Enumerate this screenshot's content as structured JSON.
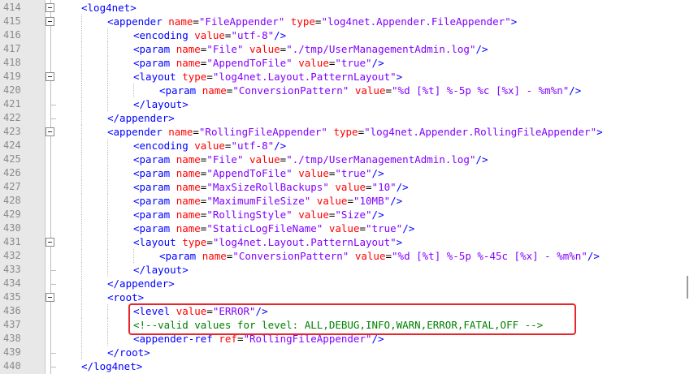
{
  "editor": {
    "lines": [
      {
        "num": "414",
        "fold": "box",
        "indent": 0,
        "tokens": [
          {
            "t": "t",
            "s": "<log4net>"
          }
        ]
      },
      {
        "num": "415",
        "fold": "box",
        "indent": 1,
        "tokens": [
          {
            "t": "t",
            "s": "<appender "
          },
          {
            "t": "a",
            "s": "name"
          },
          {
            "t": "p",
            "s": "="
          },
          {
            "t": "v",
            "s": "\"FileAppender\""
          },
          {
            "t": "p",
            "s": " "
          },
          {
            "t": "a",
            "s": "type"
          },
          {
            "t": "p",
            "s": "="
          },
          {
            "t": "v",
            "s": "\"log4net.Appender.FileAppender\""
          },
          {
            "t": "t",
            "s": ">"
          }
        ]
      },
      {
        "num": "416",
        "fold": "",
        "indent": 2,
        "tokens": [
          {
            "t": "t",
            "s": "<encoding "
          },
          {
            "t": "a",
            "s": "value"
          },
          {
            "t": "p",
            "s": "="
          },
          {
            "t": "v",
            "s": "\"utf-8\""
          },
          {
            "t": "t",
            "s": "/>"
          }
        ]
      },
      {
        "num": "417",
        "fold": "",
        "indent": 2,
        "tokens": [
          {
            "t": "t",
            "s": "<param "
          },
          {
            "t": "a",
            "s": "name"
          },
          {
            "t": "p",
            "s": "="
          },
          {
            "t": "v",
            "s": "\"File\""
          },
          {
            "t": "p",
            "s": " "
          },
          {
            "t": "a",
            "s": "value"
          },
          {
            "t": "p",
            "s": "="
          },
          {
            "t": "v",
            "s": "\"./tmp/UserManagementAdmin.log\""
          },
          {
            "t": "t",
            "s": "/>"
          }
        ]
      },
      {
        "num": "418",
        "fold": "",
        "indent": 2,
        "tokens": [
          {
            "t": "t",
            "s": "<param "
          },
          {
            "t": "a",
            "s": "name"
          },
          {
            "t": "p",
            "s": "="
          },
          {
            "t": "v",
            "s": "\"AppendToFile\""
          },
          {
            "t": "p",
            "s": " "
          },
          {
            "t": "a",
            "s": "value"
          },
          {
            "t": "p",
            "s": "="
          },
          {
            "t": "v",
            "s": "\"true\""
          },
          {
            "t": "t",
            "s": "/>"
          }
        ]
      },
      {
        "num": "419",
        "fold": "box",
        "indent": 2,
        "tokens": [
          {
            "t": "t",
            "s": "<layout "
          },
          {
            "t": "a",
            "s": "type"
          },
          {
            "t": "p",
            "s": "="
          },
          {
            "t": "v",
            "s": "\"log4net.Layout.PatternLayout\""
          },
          {
            "t": "t",
            "s": ">"
          }
        ]
      },
      {
        "num": "420",
        "fold": "",
        "indent": 3,
        "tokens": [
          {
            "t": "t",
            "s": "<param "
          },
          {
            "t": "a",
            "s": "name"
          },
          {
            "t": "p",
            "s": "="
          },
          {
            "t": "v",
            "s": "\"ConversionPattern\""
          },
          {
            "t": "p",
            "s": " "
          },
          {
            "t": "a",
            "s": "value"
          },
          {
            "t": "p",
            "s": "="
          },
          {
            "t": "v",
            "s": "\"%d [%t] %-5p %c [%x] - %m%n\""
          },
          {
            "t": "t",
            "s": "/>"
          }
        ]
      },
      {
        "num": "421",
        "fold": "end",
        "indent": 2,
        "tokens": [
          {
            "t": "t",
            "s": "</layout>"
          }
        ]
      },
      {
        "num": "422",
        "fold": "end",
        "indent": 1,
        "tokens": [
          {
            "t": "t",
            "s": "</appender>"
          }
        ]
      },
      {
        "num": "423",
        "fold": "box",
        "indent": 1,
        "tokens": [
          {
            "t": "t",
            "s": "<appender "
          },
          {
            "t": "a",
            "s": "name"
          },
          {
            "t": "p",
            "s": "="
          },
          {
            "t": "v",
            "s": "\"RollingFileAppender\""
          },
          {
            "t": "p",
            "s": " "
          },
          {
            "t": "a",
            "s": "type"
          },
          {
            "t": "p",
            "s": "="
          },
          {
            "t": "v",
            "s": "\"log4net.Appender.RollingFileAppender\""
          },
          {
            "t": "t",
            "s": ">"
          }
        ]
      },
      {
        "num": "424",
        "fold": "",
        "indent": 2,
        "tokens": [
          {
            "t": "t",
            "s": "<encoding "
          },
          {
            "t": "a",
            "s": "value"
          },
          {
            "t": "p",
            "s": "="
          },
          {
            "t": "v",
            "s": "\"utf-8\""
          },
          {
            "t": "t",
            "s": "/>"
          }
        ]
      },
      {
        "num": "425",
        "fold": "",
        "indent": 2,
        "tokens": [
          {
            "t": "t",
            "s": "<param "
          },
          {
            "t": "a",
            "s": "name"
          },
          {
            "t": "p",
            "s": "="
          },
          {
            "t": "v",
            "s": "\"File\""
          },
          {
            "t": "p",
            "s": " "
          },
          {
            "t": "a",
            "s": "value"
          },
          {
            "t": "p",
            "s": "="
          },
          {
            "t": "v",
            "s": "\"./tmp/UserManagementAdmin.log\""
          },
          {
            "t": "t",
            "s": "/>"
          }
        ]
      },
      {
        "num": "426",
        "fold": "",
        "indent": 2,
        "tokens": [
          {
            "t": "t",
            "s": "<param "
          },
          {
            "t": "a",
            "s": "name"
          },
          {
            "t": "p",
            "s": "="
          },
          {
            "t": "v",
            "s": "\"AppendToFile\""
          },
          {
            "t": "p",
            "s": " "
          },
          {
            "t": "a",
            "s": "value"
          },
          {
            "t": "p",
            "s": "="
          },
          {
            "t": "v",
            "s": "\"true\""
          },
          {
            "t": "t",
            "s": "/>"
          }
        ]
      },
      {
        "num": "427",
        "fold": "",
        "indent": 2,
        "tokens": [
          {
            "t": "t",
            "s": "<param "
          },
          {
            "t": "a",
            "s": "name"
          },
          {
            "t": "p",
            "s": "="
          },
          {
            "t": "v",
            "s": "\"MaxSizeRollBackups\""
          },
          {
            "t": "p",
            "s": " "
          },
          {
            "t": "a",
            "s": "value"
          },
          {
            "t": "p",
            "s": "="
          },
          {
            "t": "v",
            "s": "\"10\""
          },
          {
            "t": "t",
            "s": "/>"
          }
        ]
      },
      {
        "num": "428",
        "fold": "",
        "indent": 2,
        "tokens": [
          {
            "t": "t",
            "s": "<param "
          },
          {
            "t": "a",
            "s": "name"
          },
          {
            "t": "p",
            "s": "="
          },
          {
            "t": "v",
            "s": "\"MaximumFileSize\""
          },
          {
            "t": "p",
            "s": " "
          },
          {
            "t": "a",
            "s": "value"
          },
          {
            "t": "p",
            "s": "="
          },
          {
            "t": "v",
            "s": "\"10MB\""
          },
          {
            "t": "t",
            "s": "/>"
          }
        ]
      },
      {
        "num": "429",
        "fold": "",
        "indent": 2,
        "tokens": [
          {
            "t": "t",
            "s": "<param "
          },
          {
            "t": "a",
            "s": "name"
          },
          {
            "t": "p",
            "s": "="
          },
          {
            "t": "v",
            "s": "\"RollingStyle\""
          },
          {
            "t": "p",
            "s": " "
          },
          {
            "t": "a",
            "s": "value"
          },
          {
            "t": "p",
            "s": "="
          },
          {
            "t": "v",
            "s": "\"Size\""
          },
          {
            "t": "t",
            "s": "/>"
          }
        ]
      },
      {
        "num": "430",
        "fold": "",
        "indent": 2,
        "tokens": [
          {
            "t": "t",
            "s": "<param "
          },
          {
            "t": "a",
            "s": "name"
          },
          {
            "t": "p",
            "s": "="
          },
          {
            "t": "v",
            "s": "\"StaticLogFileName\""
          },
          {
            "t": "p",
            "s": " "
          },
          {
            "t": "a",
            "s": "value"
          },
          {
            "t": "p",
            "s": "="
          },
          {
            "t": "v",
            "s": "\"true\""
          },
          {
            "t": "t",
            "s": "/>"
          }
        ]
      },
      {
        "num": "431",
        "fold": "box",
        "indent": 2,
        "tokens": [
          {
            "t": "t",
            "s": "<layout "
          },
          {
            "t": "a",
            "s": "type"
          },
          {
            "t": "p",
            "s": "="
          },
          {
            "t": "v",
            "s": "\"log4net.Layout.PatternLayout\""
          },
          {
            "t": "t",
            "s": ">"
          }
        ]
      },
      {
        "num": "432",
        "fold": "",
        "indent": 3,
        "tokens": [
          {
            "t": "t",
            "s": "<param "
          },
          {
            "t": "a",
            "s": "name"
          },
          {
            "t": "p",
            "s": "="
          },
          {
            "t": "v",
            "s": "\"ConversionPattern\""
          },
          {
            "t": "p",
            "s": " "
          },
          {
            "t": "a",
            "s": "value"
          },
          {
            "t": "p",
            "s": "="
          },
          {
            "t": "v",
            "s": "\"%d [%t] %-5p %-45c [%x] - %m%n\""
          },
          {
            "t": "t",
            "s": "/>"
          }
        ]
      },
      {
        "num": "433",
        "fold": "end",
        "indent": 2,
        "tokens": [
          {
            "t": "t",
            "s": "</layout>"
          }
        ]
      },
      {
        "num": "434",
        "fold": "end",
        "indent": 1,
        "tokens": [
          {
            "t": "t",
            "s": "</appender>"
          }
        ]
      },
      {
        "num": "435",
        "fold": "box",
        "indent": 1,
        "tokens": [
          {
            "t": "t",
            "s": "<root>"
          }
        ]
      },
      {
        "num": "436",
        "fold": "",
        "indent": 2,
        "tokens": [
          {
            "t": "t",
            "s": "<level "
          },
          {
            "t": "a",
            "s": "value"
          },
          {
            "t": "p",
            "s": "="
          },
          {
            "t": "v",
            "s": "\"ERROR\""
          },
          {
            "t": "t",
            "s": "/>"
          }
        ]
      },
      {
        "num": "437",
        "fold": "",
        "indent": 2,
        "tokens": [
          {
            "t": "c",
            "s": "<!--valid values for level: ALL,DEBUG,INFO,WARN,ERROR,FATAL,OFF -->"
          }
        ]
      },
      {
        "num": "438",
        "fold": "",
        "indent": 2,
        "tokens": [
          {
            "t": "t",
            "s": "<appender-ref "
          },
          {
            "t": "a",
            "s": "ref"
          },
          {
            "t": "p",
            "s": "="
          },
          {
            "t": "v",
            "s": "\"RollingFileAppender\""
          },
          {
            "t": "t",
            "s": "/>"
          }
        ]
      },
      {
        "num": "439",
        "fold": "end",
        "indent": 1,
        "tokens": [
          {
            "t": "t",
            "s": "</root>"
          }
        ]
      },
      {
        "num": "440",
        "fold": "end",
        "indent": 0,
        "tokens": [
          {
            "t": "t",
            "s": "</log4net>"
          }
        ]
      }
    ]
  },
  "colors": {
    "tag": "#0000ff",
    "attribute": "#ff0000",
    "value": "#8000ff",
    "comment": "#008000",
    "highlight_box": "#e8262b"
  },
  "icons": {
    "fold_expanded": "minus-box-icon"
  }
}
